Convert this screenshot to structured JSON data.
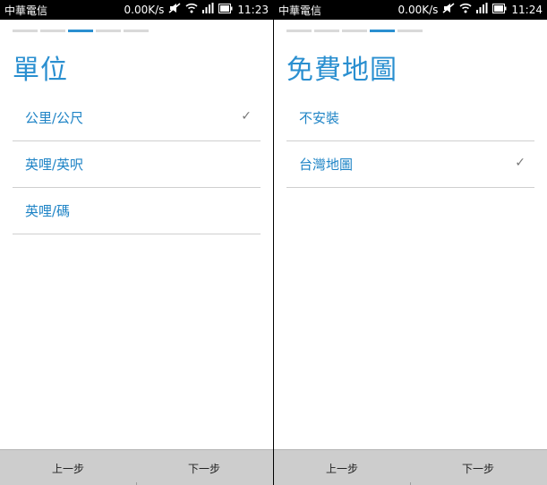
{
  "screens": [
    {
      "status": {
        "carrier": "中華電信",
        "speed": "0.00K/s",
        "time": "11:23"
      },
      "title": "單位",
      "options": [
        {
          "label": "公里/公尺",
          "checked": true
        },
        {
          "label": "英哩/英呎",
          "checked": false
        },
        {
          "label": "英哩/碼",
          "checked": false
        }
      ],
      "progress": {
        "total": 5,
        "active_index": 2
      },
      "buttons": {
        "prev": "上一步",
        "next": "下一步"
      }
    },
    {
      "status": {
        "carrier": "中華電信",
        "speed": "0.00K/s",
        "time": "11:24"
      },
      "title": "免費地圖",
      "options": [
        {
          "label": "不安裝",
          "checked": false
        },
        {
          "label": "台灣地圖",
          "checked": true
        }
      ],
      "progress": {
        "total": 5,
        "active_index": 3
      },
      "buttons": {
        "prev": "上一步",
        "next": "下一步"
      }
    }
  ],
  "check_mark": "✓",
  "colors": {
    "accent": "#2a8fd0",
    "option_text": "#1f84c6",
    "bottom_bar": "#cdcdcd"
  },
  "icons": [
    "mute-icon",
    "wifi-icon",
    "signal-icon",
    "battery-icon"
  ]
}
